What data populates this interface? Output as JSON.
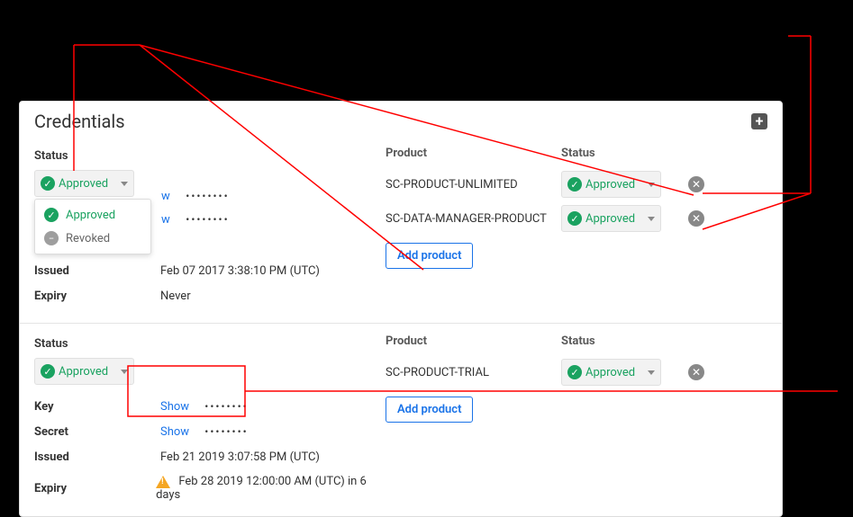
{
  "panel": {
    "title": "Credentials"
  },
  "status_options": {
    "approved": "Approved",
    "revoked": "Revoked"
  },
  "labels": {
    "status": "Status",
    "product": "Product",
    "key": "Key",
    "secret": "Secret",
    "issued": "Issued",
    "expiry": "Expiry",
    "show": "Show",
    "add_product": "Add product"
  },
  "credentials": [
    {
      "status": "Approved",
      "key_masked": "••••••••",
      "secret_masked": "••••••••",
      "issued": "Feb 07 2017 3:38:10 PM (UTC)",
      "expiry": "Never",
      "expiry_warning": false,
      "products": [
        {
          "name": "SC-PRODUCT-UNLIMITED",
          "status": "Approved"
        },
        {
          "name": "SC-DATA-MANAGER-PRODUCT",
          "status": "Approved"
        }
      ]
    },
    {
      "status": "Approved",
      "key_masked": "••••••••",
      "secret_masked": "••••••••",
      "issued": "Feb 21 2019 3:07:58 PM (UTC)",
      "expiry": "Feb 28 2019 12:00:00 AM (UTC) in 6 days",
      "expiry_warning": true,
      "products": [
        {
          "name": "SC-PRODUCT-TRIAL",
          "status": "Approved"
        }
      ]
    }
  ]
}
